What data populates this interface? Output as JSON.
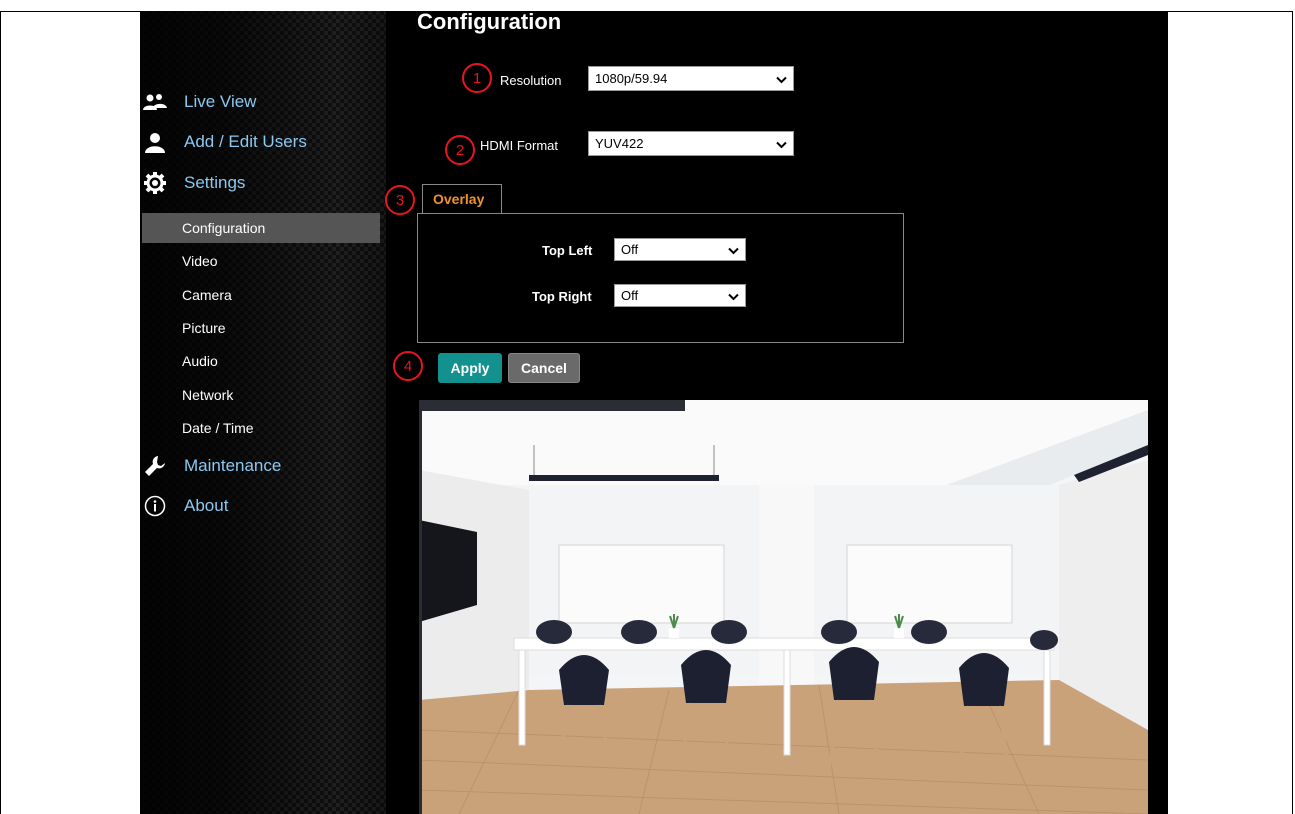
{
  "page": {
    "main_title": "Configuration"
  },
  "sidebar": {
    "nav": [
      {
        "label": "Live View",
        "icon": "users-icon"
      },
      {
        "label": "Add / Edit Users",
        "icon": "user-icon"
      },
      {
        "label": "Settings",
        "icon": "gear-icon"
      }
    ],
    "settings_items": [
      {
        "label": "Configuration",
        "active": true
      },
      {
        "label": "Video",
        "active": false
      },
      {
        "label": "Camera",
        "active": false
      },
      {
        "label": "Picture",
        "active": false
      },
      {
        "label": "Audio",
        "active": false
      },
      {
        "label": "Network",
        "active": false
      },
      {
        "label": "Date / Time",
        "active": false
      }
    ],
    "bottom_nav": [
      {
        "label": "Maintenance",
        "icon": "wrench-icon"
      },
      {
        "label": "About",
        "icon": "info-icon"
      }
    ]
  },
  "form": {
    "resolution": {
      "label": "Resolution",
      "value": "1080p/59.94"
    },
    "hdmi_format": {
      "label": "HDMI Format",
      "value": "YUV422"
    }
  },
  "overlay_tab": {
    "label": "Overlay",
    "top_left": {
      "label": "Top Left",
      "value": "Off"
    },
    "top_right": {
      "label": "Top Right",
      "value": "Off"
    }
  },
  "buttons": {
    "apply": "Apply",
    "cancel": "Cancel"
  },
  "markers": [
    "1",
    "2",
    "3",
    "4"
  ],
  "colors": {
    "nav_text": "#8cc8f0",
    "tab_text": "#f0922a",
    "apply_bg": "#13918f",
    "marker": "#e8141e"
  }
}
